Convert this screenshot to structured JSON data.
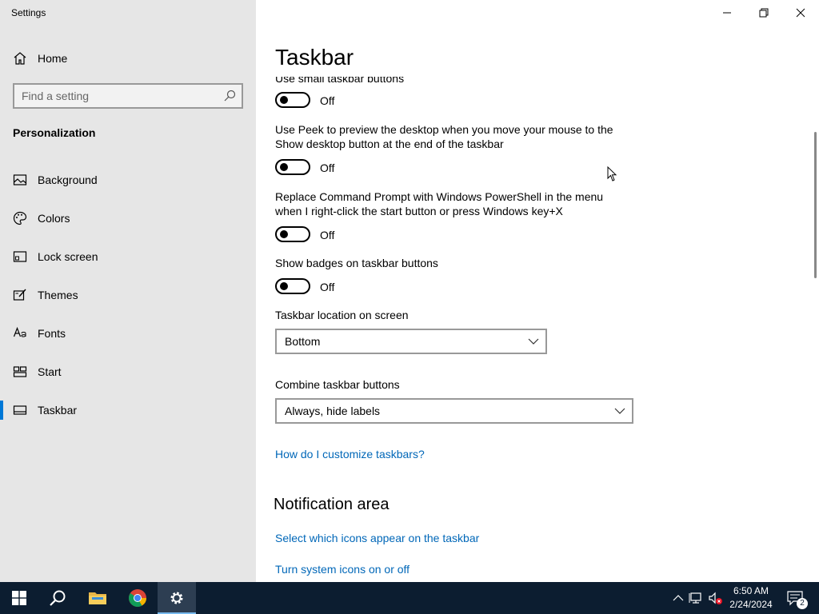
{
  "window": {
    "title": "Settings",
    "minimize_icon": "minimize-icon",
    "restore_icon": "restore-icon",
    "close_icon": "close-icon"
  },
  "sidebar": {
    "home_label": "Home",
    "search_placeholder": "Find a setting",
    "section_title": "Personalization",
    "items": [
      {
        "label": "Background",
        "icon": "picture-icon"
      },
      {
        "label": "Colors",
        "icon": "palette-icon"
      },
      {
        "label": "Lock screen",
        "icon": "lock-screen-icon"
      },
      {
        "label": "Themes",
        "icon": "brush-icon"
      },
      {
        "label": "Fonts",
        "icon": "font-icon"
      },
      {
        "label": "Start",
        "icon": "start-icon"
      },
      {
        "label": "Taskbar",
        "icon": "taskbar-icon",
        "selected": true
      }
    ]
  },
  "main": {
    "title": "Taskbar",
    "settings": [
      {
        "text": "Use small taskbar buttons",
        "state": "Off"
      },
      {
        "text": "Use Peek to preview the desktop when you move your mouse to the Show desktop button at the end of the taskbar",
        "state": "Off"
      },
      {
        "text": "Replace Command Prompt with Windows PowerShell in the menu when I right-click the start button or press Windows key+X",
        "state": "Off"
      },
      {
        "text": "Show badges on taskbar buttons",
        "state": "Off"
      }
    ],
    "location_label": "Taskbar location on screen",
    "location_value": "Bottom",
    "combine_label": "Combine taskbar buttons",
    "combine_value": "Always, hide labels",
    "customize_link": "How do I customize taskbars?",
    "notification_heading": "Notification area",
    "link_select_icons": "Select which icons appear on the taskbar",
    "link_system_icons": "Turn system icons on or off"
  },
  "taskbar": {
    "clock_time": "6:50 AM",
    "clock_date": "2/24/2024",
    "notification_count": "2",
    "accent_color": "#0078d7",
    "background_color": "#0c1d30"
  }
}
